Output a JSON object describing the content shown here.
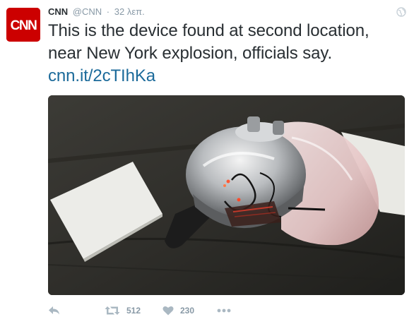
{
  "tweet": {
    "author_name": "CNN",
    "author_handle": "@CNN",
    "separator": "·",
    "timestamp": "32 λεπ.",
    "avatar_text": "CNN",
    "text": "This is the device found at second location, near New York explosion, officials say.",
    "link": "cnn.it/2cTIhKa"
  },
  "actions": {
    "reply_icon": "reply-icon",
    "retweet_icon": "retweet-icon",
    "retweet_count": "512",
    "like_icon": "heart-icon",
    "like_count": "230",
    "more_icon": "more-dots-icon"
  },
  "colors": {
    "brand_red": "#cc0000",
    "link_blue": "#1b6a9a",
    "text_dark": "#292f33",
    "muted_gray": "#8899a6",
    "icon_gray": "#aab8c2"
  }
}
